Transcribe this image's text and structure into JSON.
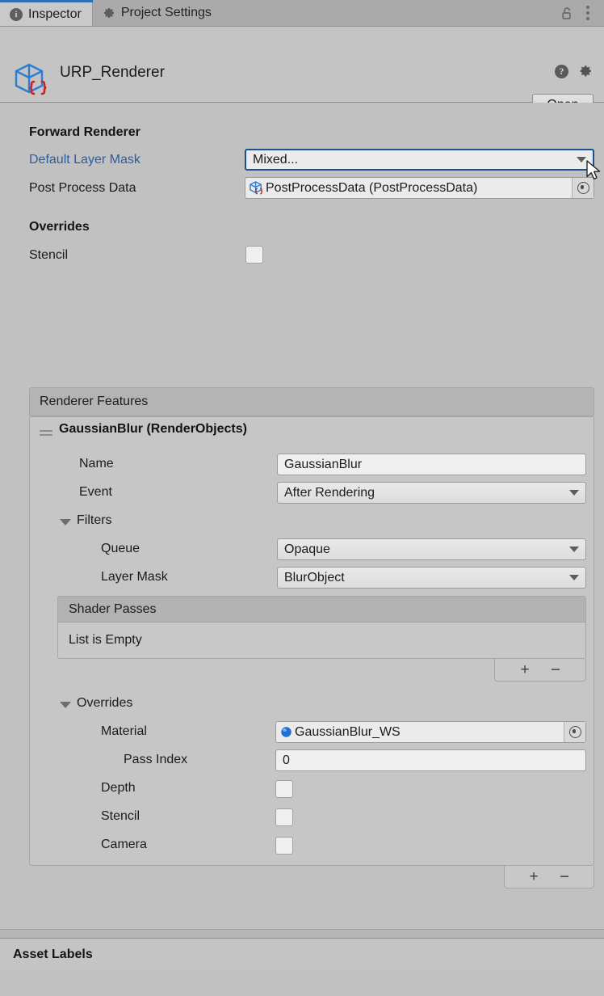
{
  "window": {
    "tabs": [
      {
        "label": "Inspector",
        "icon": "info-icon",
        "active": true
      },
      {
        "label": "Project Settings",
        "icon": "gear-icon",
        "active": false
      }
    ],
    "lock_icon": "lock-open-icon",
    "menu_icon": "kebab-menu-icon"
  },
  "object_header": {
    "icon": "scriptable-object-icon",
    "title": "URP_Renderer",
    "help_icon": "help-icon",
    "preset_icon": "gear-icon",
    "open_label": "Open"
  },
  "forward_renderer": {
    "title": "Forward Renderer",
    "default_layer_mask": {
      "label": "Default Layer Mask",
      "value": "Mixed...",
      "focused": true
    },
    "post_process_data": {
      "label": "Post Process Data",
      "value": "PostProcessData (PostProcessData)",
      "icon": "scriptable-object-icon"
    }
  },
  "overrides_top": {
    "title": "Overrides",
    "stencil": {
      "label": "Stencil",
      "checked": false
    }
  },
  "renderer_features": {
    "header": "Renderer Features",
    "feature": {
      "title": "GaussianBlur (RenderObjects)",
      "drag_handle_icon": "drag-handle-icon",
      "name": {
        "label": "Name",
        "value": "GaussianBlur"
      },
      "event": {
        "label": "Event",
        "value": "After Rendering"
      },
      "filters": {
        "label": "Filters",
        "expanded": true,
        "queue": {
          "label": "Queue",
          "value": "Opaque"
        },
        "layer_mask": {
          "label": "Layer Mask",
          "value": "BlurObject"
        },
        "shader_passes": {
          "header": "Shader Passes",
          "empty_text": "List is Empty",
          "add_label": "+",
          "remove_label": "−"
        }
      },
      "overrides": {
        "label": "Overrides",
        "expanded": true,
        "material": {
          "label": "Material",
          "value": "GaussianBlur_WS",
          "icon": "material-sphere-icon"
        },
        "pass_index": {
          "label": "Pass Index",
          "value": "0"
        },
        "depth": {
          "label": "Depth",
          "checked": false
        },
        "stencil": {
          "label": "Stencil",
          "checked": false
        },
        "camera": {
          "label": "Camera",
          "checked": false
        }
      }
    },
    "add_label": "+",
    "remove_label": "−"
  },
  "footer": {
    "asset_labels": "Asset Labels"
  },
  "colors": {
    "background": "#c1c1c1",
    "accent_blue": "#2c6fb5",
    "link_blue": "#2c5d9e",
    "focus_border": "#1c4f8f",
    "panel": "#c6c6c6",
    "header_strip": "#b4b4b4"
  }
}
